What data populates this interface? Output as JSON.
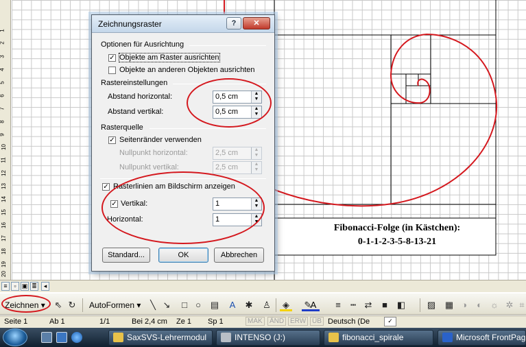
{
  "ruler": {
    "numbers": [
      "1",
      "2",
      "3",
      "4",
      "5",
      "6",
      "7",
      "8",
      "9",
      "10",
      "11",
      "12",
      "13",
      "14",
      "15",
      "16",
      "17",
      "18",
      "19",
      "20"
    ]
  },
  "document": {
    "fib_title": "Fibonacci-Folge (in Kästchen):",
    "fib_sequence": "0-1-1-2-3-5-8-13-21"
  },
  "dialog": {
    "title": "Zeichnungsraster",
    "help_label": "?",
    "close_label": "✕",
    "align_group": "Optionen für Ausrichtung",
    "snap_to_grid": {
      "label": "Objekte am Raster ausrichten",
      "checked": true
    },
    "snap_to_objects": {
      "label": "Objekte an anderen Objekten ausrichten",
      "checked": false
    },
    "grid_group": "Rastereinstellungen",
    "horiz_spacing": {
      "label": "Abstand horizontal:",
      "value": "0,5 cm"
    },
    "vert_spacing": {
      "label": "Abstand vertikal:",
      "value": "0,5 cm"
    },
    "origin_group": "Rasterquelle",
    "use_margins": {
      "label": "Seitenränder verwenden",
      "checked": true
    },
    "origin_horiz": {
      "label": "Nullpunkt horizontal:",
      "value": "2,5 cm"
    },
    "origin_vert": {
      "label": "Nullpunkt vertikal:",
      "value": "2,5 cm"
    },
    "show_gridlines": {
      "label": "Rasterlinien am Bildschirm anzeigen",
      "checked": true
    },
    "vertical_every": {
      "label": "Vertikal:",
      "value": "1",
      "checked": true
    },
    "horizontal_every": {
      "label": "Horizontal:",
      "value": "1"
    },
    "standard_button": "Standard...",
    "ok_button": "OK",
    "cancel_button": "Abbrechen"
  },
  "drawbar": {
    "draw_menu": "Zeichnen ▾",
    "autoshapes_menu": "AutoFormen ▾"
  },
  "statusbar": {
    "page": "Seite  1",
    "section": "Ab  1",
    "pages": "1/1",
    "position": "Bei  2,4 cm",
    "line": "Ze  1",
    "column": "Sp  1",
    "mak": "MAK",
    "and": "ÄND",
    "erw": "ERW",
    "ub": "ÜB",
    "language": "Deutsch (De"
  },
  "taskbar": {
    "tasks": [
      "SaxSVS-Lehrermodul",
      "INTENSO (J:)",
      "fibonacci_spirale",
      "Microsoft FrontPag"
    ]
  },
  "colors": {
    "annotation": "#d4181e",
    "spiral": "#d4181e",
    "taskbar": "#1e3246"
  }
}
